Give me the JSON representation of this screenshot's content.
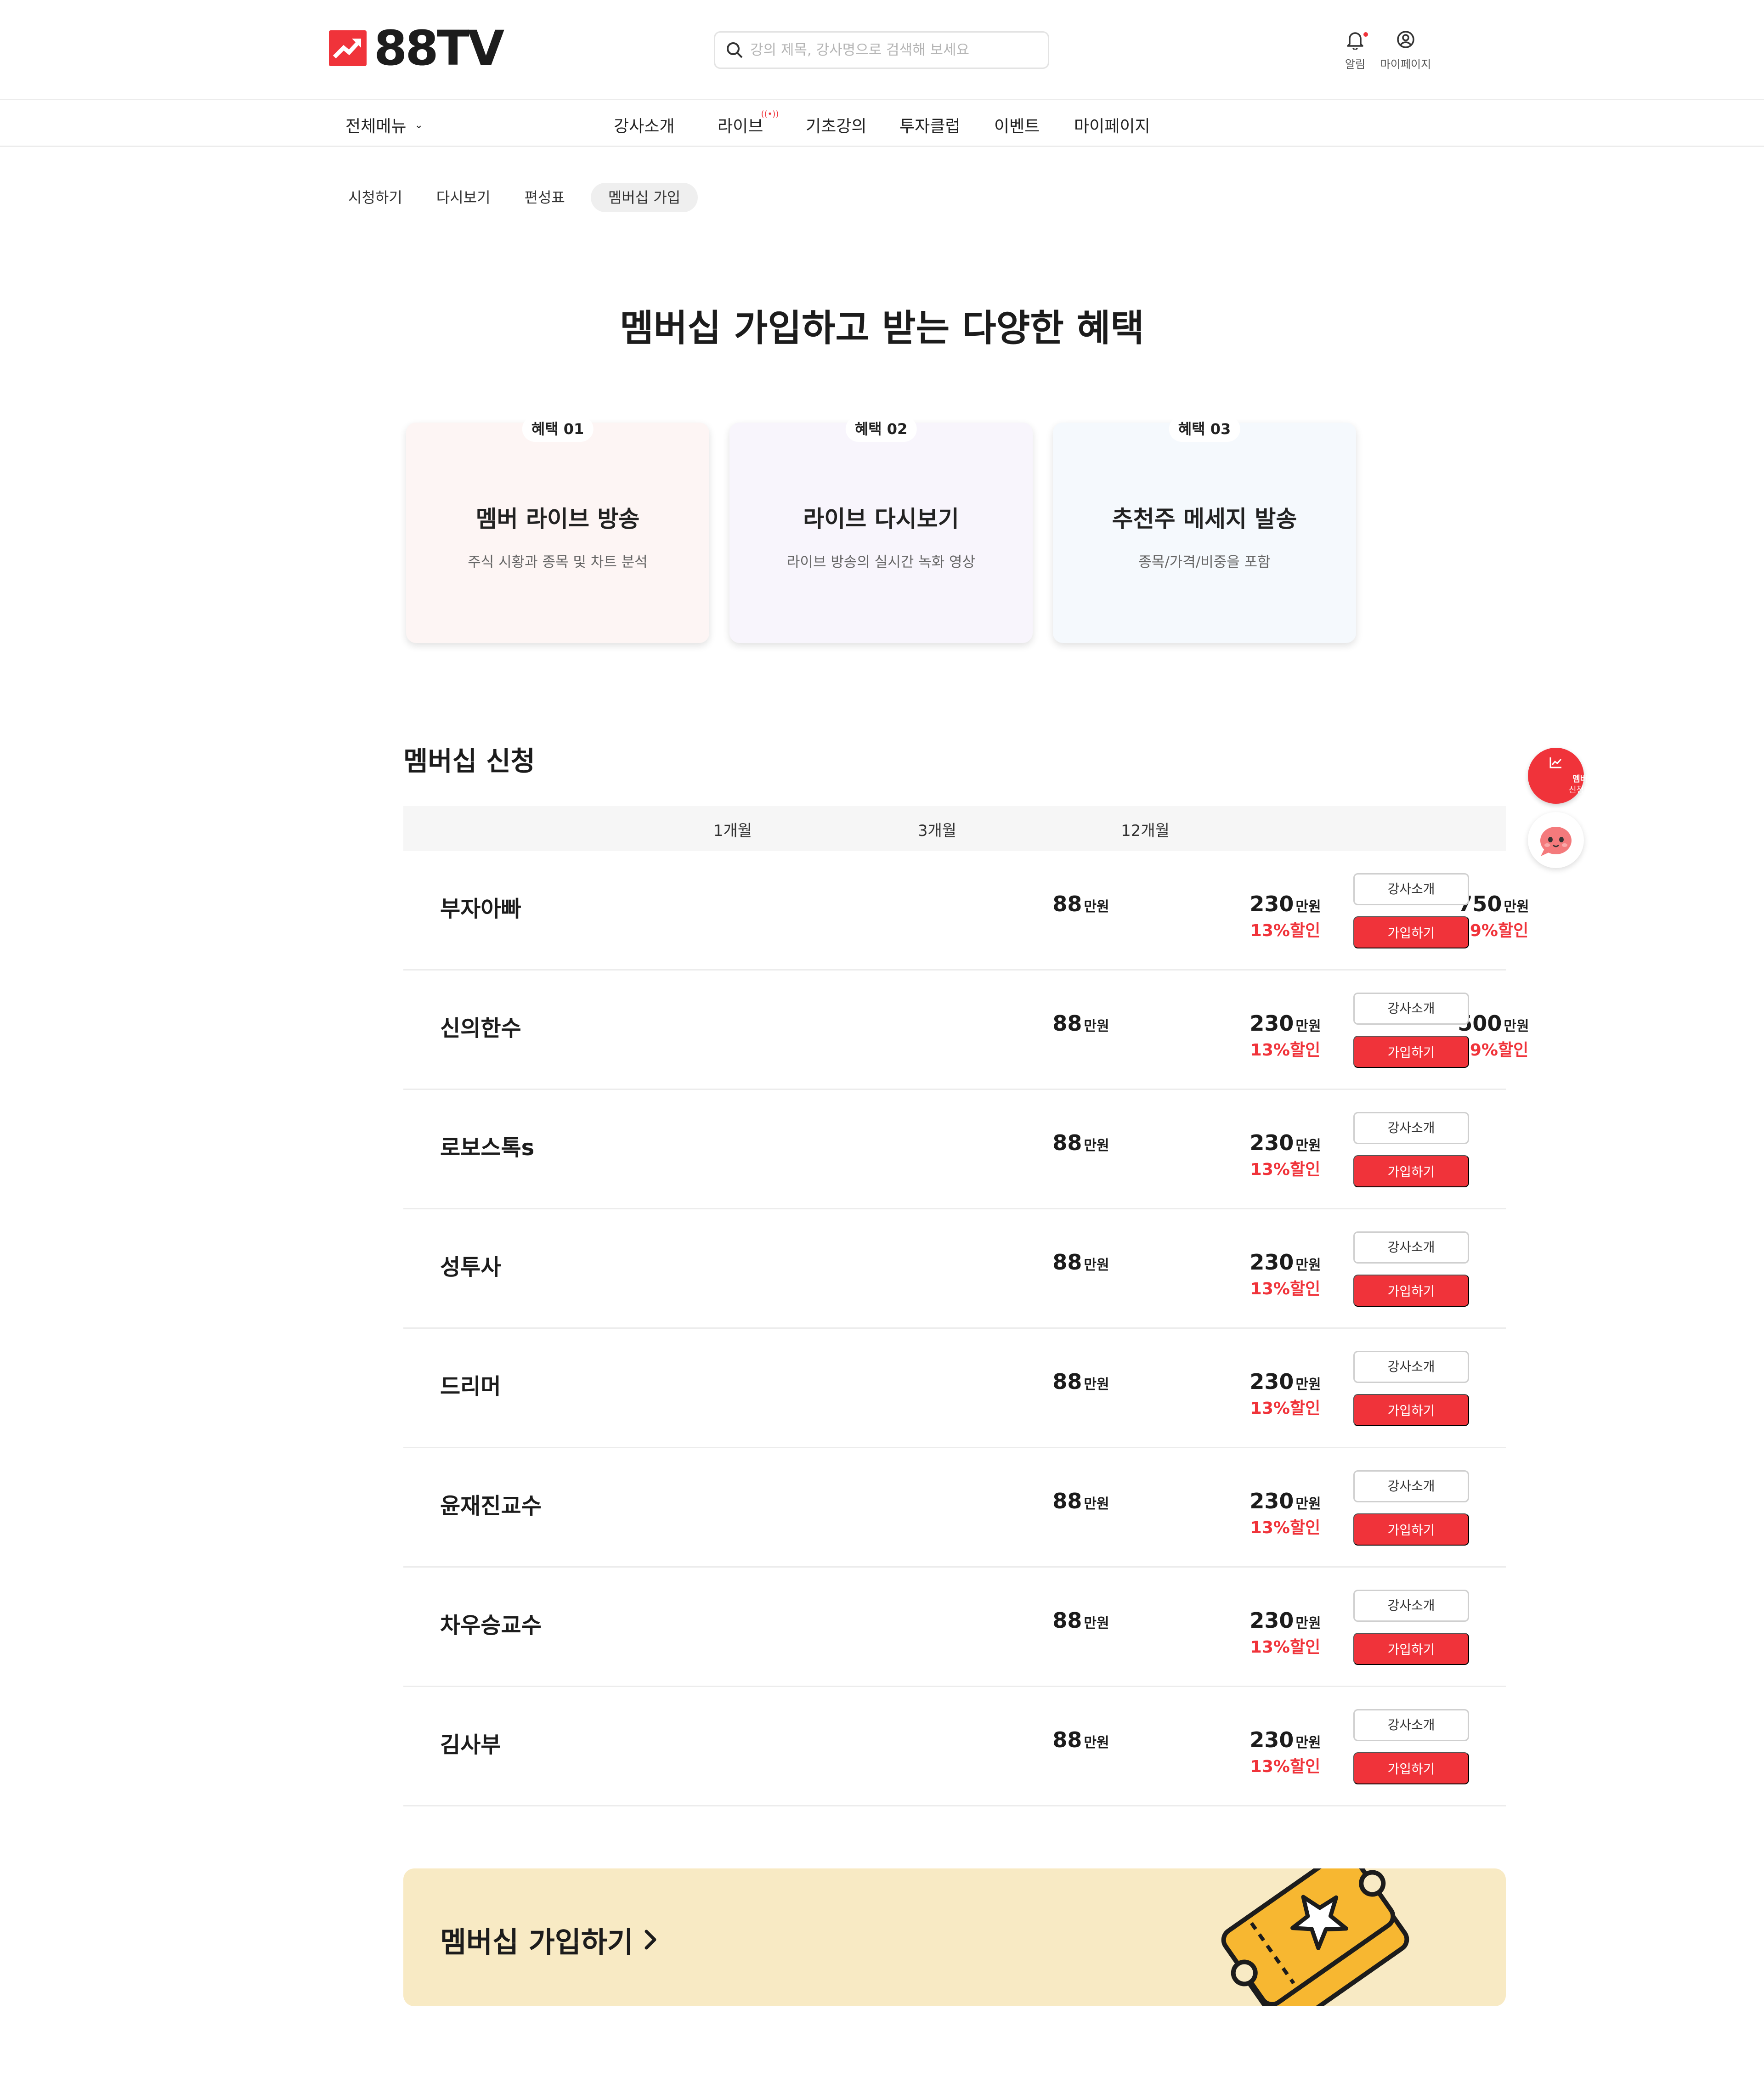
{
  "header": {
    "logo_text": "88TV",
    "search_placeholder": "강의 제목, 강사명으로 검색해 보세요",
    "alarm_label": "알림",
    "mypage_label": "마이페이지"
  },
  "gnb": {
    "all_menu": "전체메뉴",
    "items": [
      "강사소개",
      "라이브",
      "기초강의",
      "투자클럽",
      "이벤트",
      "마이페이지"
    ]
  },
  "subtabs": [
    "시청하기",
    "다시보기",
    "편성표",
    "멤버십 가입"
  ],
  "page_title": "멤버십 가입하고 받는 다양한 혜택",
  "benefits": [
    {
      "tag": "혜택 01",
      "title": "멤버 라이브 방송",
      "desc": "주식 시황과 종목 및 차트 분석"
    },
    {
      "tag": "혜택 02",
      "title": "라이브 다시보기",
      "desc": "라이브 방송의 실시간 녹화 영상"
    },
    {
      "tag": "혜택 03",
      "title": "추천주 메세지 발송",
      "desc": "종목/가격/비중을 포함"
    }
  ],
  "apply": {
    "title": "멤버십 신청",
    "columns": [
      "1개월",
      "3개월",
      "12개월"
    ],
    "unit": "만원",
    "intro_label": "강사소개",
    "join_label": "가입하기",
    "rows": [
      {
        "name": "부자아빠",
        "m1": "88",
        "m3": "230",
        "m3_disc": "13%할인",
        "m12": "750",
        "m12_disc": "29%할인"
      },
      {
        "name": "신의한수",
        "m1": "88",
        "m3": "230",
        "m3_disc": "13%할인",
        "m12": "500",
        "m12_disc": "29%할인"
      },
      {
        "name": "로보스톡s",
        "m1": "88",
        "m3": "230",
        "m3_disc": "13%할인"
      },
      {
        "name": "성투사",
        "m1": "88",
        "m3": "230",
        "m3_disc": "13%할인"
      },
      {
        "name": "드리머",
        "m1": "88",
        "m3": "230",
        "m3_disc": "13%할인"
      },
      {
        "name": "윤재진교수",
        "m1": "88",
        "m3": "230",
        "m3_disc": "13%할인"
      },
      {
        "name": "차우승교수",
        "m1": "88",
        "m3": "230",
        "m3_disc": "13%할인"
      },
      {
        "name": "김사부",
        "m1": "88",
        "m3": "230",
        "m3_disc": "13%할인"
      }
    ]
  },
  "banner": {
    "text": "멤버십 가입하기"
  },
  "float": {
    "join_line1": "멤버십",
    "join_line2": "신청하기"
  },
  "colors": {
    "accent": "#f0333a",
    "banner_bg": "#f8eac4",
    "ticket": "#f7b731"
  }
}
